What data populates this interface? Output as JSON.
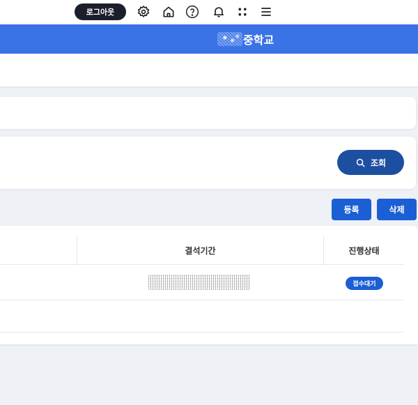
{
  "topbar": {
    "logout_label": "로그아웃",
    "icons": [
      "gear-icon",
      "home-icon",
      "help-icon",
      "bell-icon",
      "apps-icon",
      "menu-icon"
    ]
  },
  "header": {
    "school_name": "중학교"
  },
  "actions": {
    "search_label": "조회",
    "register_label": "등록",
    "delete_label": "삭제"
  },
  "table": {
    "columns": [
      "결석기간",
      "진행상태"
    ],
    "rows": [
      {
        "period": "",
        "status": "접수대기"
      }
    ]
  },
  "colors": {
    "header_blue": "#3a73e6",
    "search_button": "#1d4fa1",
    "action_button": "#1c5fd4",
    "logout_button": "#1b1e2b",
    "background": "#eef1f6"
  }
}
